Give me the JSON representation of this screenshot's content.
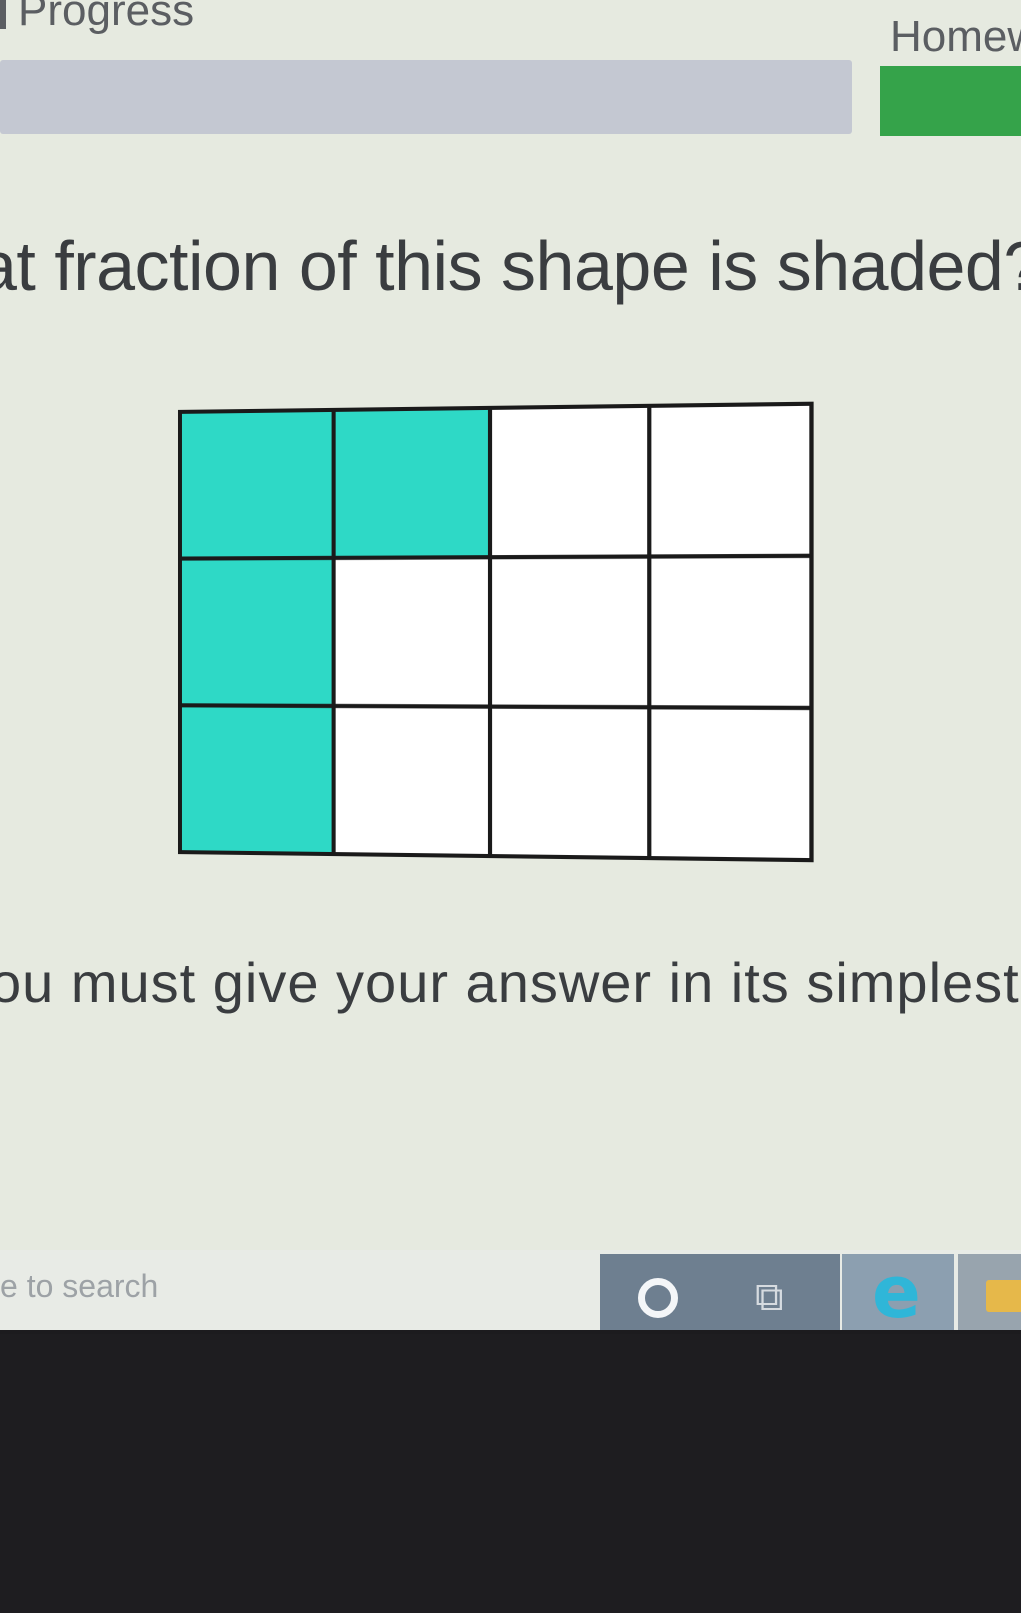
{
  "header": {
    "progress_label": "Progress",
    "homework_label": "Homew"
  },
  "question": {
    "text": "at fraction of this shape is shaded?"
  },
  "shape": {
    "rows": 3,
    "columns": 4,
    "shaded_cells": [
      [
        0,
        0
      ],
      [
        0,
        1
      ],
      [
        1,
        0
      ],
      [
        2,
        0
      ]
    ],
    "shade_color": "#2ed9c6",
    "line_color": "#1a1a1a"
  },
  "instruction": {
    "text": "ou must give your answer in its simplest"
  },
  "taskbar": {
    "search_placeholder": "e to search",
    "icons": [
      "cortana-icon",
      "task-view-icon",
      "edge-browser-icon",
      "file-explorer-icon"
    ]
  }
}
